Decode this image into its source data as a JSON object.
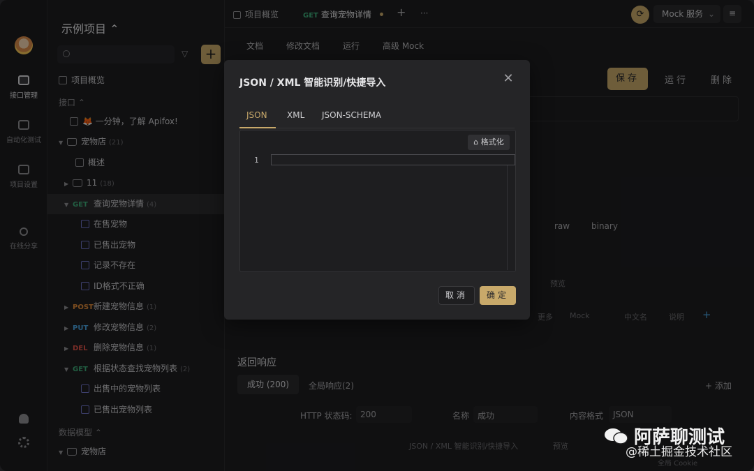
{
  "window": {
    "traffic_lights": [
      "#fe5f57",
      "#febc2e",
      "#28c840"
    ]
  },
  "rail": {
    "items": [
      {
        "label": "接口管理",
        "icon": "api-icon",
        "active": true
      },
      {
        "label": "自动化测试",
        "icon": "automation-icon"
      },
      {
        "label": "项目设置",
        "icon": "settings-icon"
      },
      {
        "label": "在线分享",
        "icon": "share-icon"
      }
    ],
    "bottom_icons": [
      "bell-icon",
      "gear-icon"
    ]
  },
  "sidebar": {
    "project_title": "示例项目 ⌃",
    "overview": "项目概览",
    "section_api": "接口 ⌃",
    "tree": [
      {
        "type": "doc",
        "label": "🦊 一分钟，了解 Apifox!"
      },
      {
        "type": "folder",
        "label": "宠物店",
        "count": "(21)"
      },
      {
        "type": "doc",
        "label": "概述"
      },
      {
        "type": "folder",
        "label": "11",
        "count": "(18)"
      },
      {
        "type": "api",
        "method": "GET",
        "label": "查询宠物详情",
        "count": "(4)",
        "selected": true
      },
      {
        "type": "case",
        "label": "在售宠物"
      },
      {
        "type": "case",
        "label": "已售出宠物"
      },
      {
        "type": "case",
        "label": "记录不存在"
      },
      {
        "type": "case",
        "label": "ID格式不正确"
      },
      {
        "type": "api",
        "method": "POST",
        "label": "新建宠物信息",
        "count": "(1)"
      },
      {
        "type": "api",
        "method": "PUT",
        "label": "修改宠物信息",
        "count": "(2)"
      },
      {
        "type": "api",
        "method": "DEL",
        "label": "删除宠物信息",
        "count": "(1)"
      },
      {
        "type": "api",
        "method": "GET",
        "label": "根据状态查找宠物列表",
        "count": "(2)"
      },
      {
        "type": "case",
        "label": "出售中的宠物列表"
      },
      {
        "type": "case",
        "label": "已售出宠物列表"
      }
    ],
    "section_model": "数据模型 ⌃",
    "model_folder": "宠物店"
  },
  "top": {
    "tabs": [
      "项目概览",
      "查询宠物详情"
    ],
    "tab_method": "GET",
    "plus": "+",
    "more": "···",
    "mock_service": "Mock 服务",
    "mock_caret": "⌄"
  },
  "subtabs": [
    "文档",
    "修改文档",
    "运行",
    "高级 Mock"
  ],
  "actions": {
    "save": "保存",
    "run": "运行",
    "delete": "删除"
  },
  "background_text": {
    "raw": "raw",
    "binary": "binary",
    "preview": "预览",
    "more": "更多",
    "mock": "Mock",
    "cn_name": "中文名",
    "desc": "说明",
    "resp_title": "返回响应",
    "resp_tab_success": "成功 (200)",
    "resp_tab_global": "全局响应(2)",
    "add": "+ 添加",
    "http_status_label": "HTTP 状态码:",
    "http_status_value": "200",
    "name_label": "名称",
    "name_value": "成功",
    "content_format_label": "内容格式",
    "content_format_value": "JSON",
    "import_link": "JSON / XML 智能识别/快捷导入",
    "preview2": "预览",
    "cookie": "全局 Cookie"
  },
  "modal": {
    "title": "JSON / XML 智能识别/快捷导入",
    "tabs": [
      "JSON",
      "XML",
      "JSON-SCHEMA"
    ],
    "active_tab": "JSON",
    "format_button": "格式化",
    "line_number": "1",
    "cancel": "取消",
    "ok": "确定",
    "accent": "#c8a96a"
  },
  "watermark": {
    "line1": "阿萨聊测试",
    "line2": "@稀土掘金技术社区"
  }
}
